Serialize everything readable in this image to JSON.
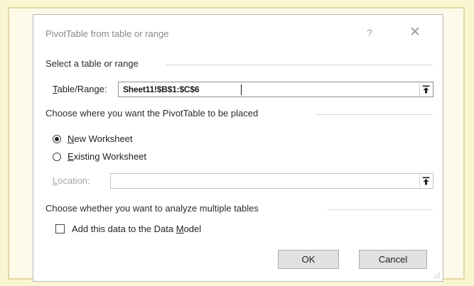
{
  "dialog": {
    "title": "PivotTable from table or range",
    "help_glyph": "?",
    "close_glyph": "✕"
  },
  "source": {
    "section_label": "Select a table or range",
    "field_label_accel": "T",
    "field_label_rest": "able/Range:",
    "value": "Sheet11!$B$1:$C$6"
  },
  "placement": {
    "section_label": "Choose where you want the PivotTable to be placed",
    "new_ws_accel": "N",
    "new_ws_rest": "ew Worksheet",
    "existing_ws_accel": "E",
    "existing_ws_rest": "xisting Worksheet",
    "selected": "new_worksheet",
    "location_accel": "L",
    "location_rest": "ocation:",
    "location_value": ""
  },
  "multiple": {
    "section_label": "Choose whether you want to analyze multiple tables",
    "checkbox_text_pre": "Add this data to the Data ",
    "checkbox_accel": "M",
    "checkbox_text_post": "odel",
    "checked": false
  },
  "buttons": {
    "ok": "OK",
    "cancel": "Cancel"
  },
  "icons": {
    "collapse": "collapse-dialog-icon",
    "resize": "resize-grip-icon"
  },
  "colors": {
    "page_background": "#fbf6d2",
    "dialog_background": "#ffffff",
    "button_face": "#e1e1e1"
  }
}
